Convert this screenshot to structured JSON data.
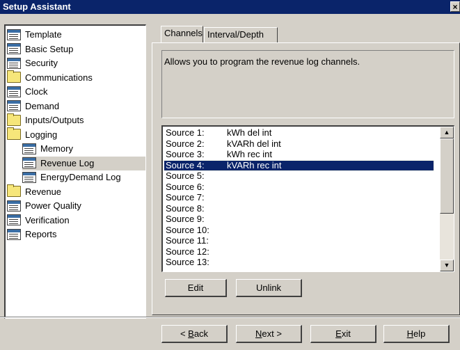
{
  "window": {
    "title": "Setup Assistant",
    "close_glyph": "×"
  },
  "tree": {
    "items": [
      {
        "label": "Template",
        "icon": "document-icon",
        "level": 0
      },
      {
        "label": "Basic Setup",
        "icon": "document-icon",
        "level": 0
      },
      {
        "label": "Security",
        "icon": "document-icon",
        "level": 0
      },
      {
        "label": "Communications",
        "icon": "folder-icon",
        "level": 0
      },
      {
        "label": "Clock",
        "icon": "document-icon",
        "level": 0
      },
      {
        "label": "Demand",
        "icon": "document-icon",
        "level": 0
      },
      {
        "label": "Inputs/Outputs",
        "icon": "folder-icon",
        "level": 0
      },
      {
        "label": "Logging",
        "icon": "folder-icon",
        "level": 0
      },
      {
        "label": "Memory",
        "icon": "document-icon",
        "level": 1
      },
      {
        "label": "Revenue Log",
        "icon": "document-icon",
        "level": 1,
        "selected": true
      },
      {
        "label": "EnergyDemand Log",
        "icon": "document-icon",
        "level": 1
      },
      {
        "label": "Revenue",
        "icon": "folder-icon",
        "level": 0
      },
      {
        "label": "Power Quality",
        "icon": "document-icon",
        "level": 0
      },
      {
        "label": "Verification",
        "icon": "document-icon",
        "level": 0
      },
      {
        "label": "Reports",
        "icon": "document-icon",
        "level": 0
      }
    ]
  },
  "tabs": [
    {
      "label": "Channels",
      "active": true
    },
    {
      "label": "Interval/Depth",
      "active": false
    }
  ],
  "description": "Allows you to program the revenue log channels.",
  "channels": [
    {
      "source": "Source 1:",
      "value": "kWh del int"
    },
    {
      "source": "Source 2:",
      "value": "kVARh del int"
    },
    {
      "source": "Source 3:",
      "value": "kWh rec int"
    },
    {
      "source": "Source 4:",
      "value": "kVARh rec int",
      "selected": true
    },
    {
      "source": "Source 5:",
      "value": ""
    },
    {
      "source": "Source 6:",
      "value": ""
    },
    {
      "source": "Source 7:",
      "value": ""
    },
    {
      "source": "Source 8:",
      "value": ""
    },
    {
      "source": "Source 9:",
      "value": ""
    },
    {
      "source": "Source 10:",
      "value": ""
    },
    {
      "source": "Source 11:",
      "value": ""
    },
    {
      "source": "Source 12:",
      "value": ""
    },
    {
      "source": "Source 13:",
      "value": ""
    }
  ],
  "actions": {
    "edit": "Edit",
    "unlink": "Unlink"
  },
  "nav": {
    "back_prefix": "< ",
    "back_accel": "B",
    "back_rest": "ack",
    "next_accel": "N",
    "next_rest": "ext >",
    "exit_accel": "E",
    "exit_rest": "xit",
    "help_accel": "H",
    "help_rest": "elp"
  },
  "colors": {
    "selection": "#0a246a",
    "titlebar": "#0a246a",
    "face": "#d4d0c8"
  }
}
